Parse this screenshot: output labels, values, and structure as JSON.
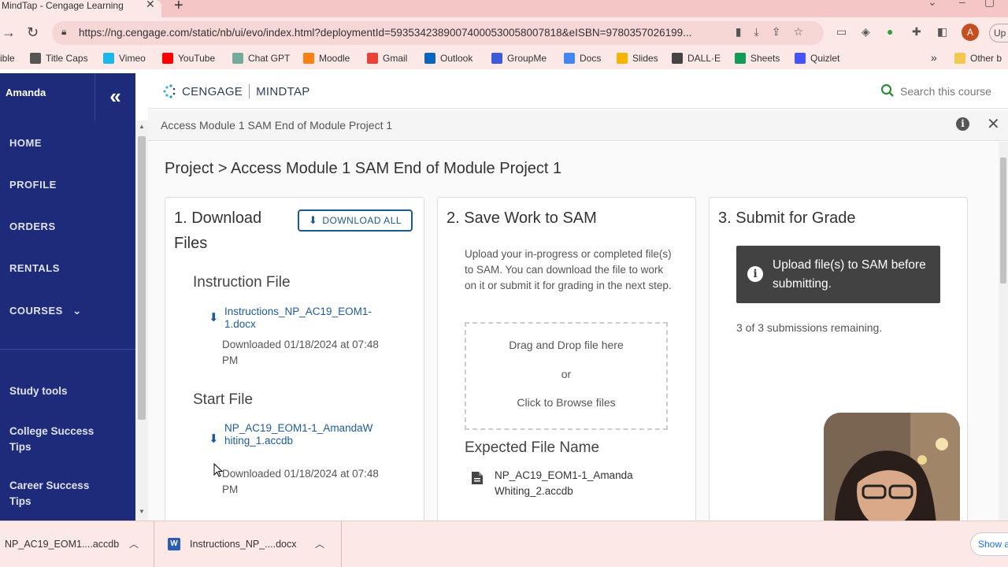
{
  "browser": {
    "tab_title": "MindTap - Cengage Learning",
    "url": "https://ng.cengage.com/static/nb/ui/evo/index.html?deploymentId=59353423890074000530058007818&eISBN=9780357026199...",
    "profile_initial": "A",
    "update_label": "Up",
    "bookmarks": [
      {
        "label": "ible",
        "icon": "bookmark-icon",
        "color": "#888888"
      },
      {
        "label": "Title Caps",
        "icon": "title-caps-icon",
        "color": "#555555"
      },
      {
        "label": "Vimeo",
        "icon": "vimeo-icon",
        "color": "#1ab7ea"
      },
      {
        "label": "YouTube",
        "icon": "youtube-icon",
        "color": "#ff0000"
      },
      {
        "label": "Chat GPT",
        "icon": "chatgpt-icon",
        "color": "#74aa9c"
      },
      {
        "label": "Moodle",
        "icon": "moodle-icon",
        "color": "#f98012"
      },
      {
        "label": "Gmail",
        "icon": "gmail-icon",
        "color": "#ea4335"
      },
      {
        "label": "Outlook",
        "icon": "outlook-icon",
        "color": "#0a64c2"
      },
      {
        "label": "GroupMe",
        "icon": "groupme-icon",
        "color": "#3b5bdb"
      },
      {
        "label": "Docs",
        "icon": "docs-icon",
        "color": "#4285f4"
      },
      {
        "label": "Slides",
        "icon": "slides-icon",
        "color": "#f4b400"
      },
      {
        "label": "DALL·E",
        "icon": "dalle-icon",
        "color": "#444444"
      },
      {
        "label": "Sheets",
        "icon": "sheets-icon",
        "color": "#0f9d58"
      },
      {
        "label": "Quizlet",
        "icon": "quizlet-icon",
        "color": "#4255ff"
      }
    ],
    "bookmarks_more": "»",
    "other_bookmarks": "Other b"
  },
  "sidebar": {
    "user": "Amanda",
    "collapse_glyph": "«",
    "nav_items": [
      "HOME",
      "PROFILE",
      "ORDERS",
      "RENTALS",
      "COURSES"
    ],
    "courses_chevron": "⌄",
    "tools": [
      "Study tools",
      "College Success Tips",
      "Career Success Tips"
    ]
  },
  "header": {
    "brand": "CENGAGE",
    "product": "MINDTAP",
    "search_placeholder": "Search this course"
  },
  "activity": {
    "title": "Access Module 1 SAM End of Module Project 1"
  },
  "page": {
    "breadcrumb_root": "Project",
    "breadcrumb_sep": ">",
    "breadcrumb_current": "Access Module 1 SAM End of Module Project 1"
  },
  "download_card": {
    "title": "1. Download Files",
    "download_all": "DOWNLOAD ALL",
    "instruction_heading": "Instruction File",
    "instruction_file": "Instructions_NP_AC19_EOM1-1.docx",
    "instruction_status": "Downloaded 01/18/2024 at 07:48 PM",
    "start_heading": "Start File",
    "start_file": "NP_AC19_EOM1-1_AmandaWhiting_1.accdb",
    "start_status": "Downloaded 01/18/2024 at 07:48 PM"
  },
  "save_card": {
    "title": "2. Save Work to SAM",
    "description": "Upload your in-progress or completed file(s) to SAM. You can download the file to work on it or submit it for grading in the next step.",
    "drop_line1": "Drag and Drop file here",
    "drop_or": "or",
    "drop_line2": "Click to Browse files",
    "expected_heading": "Expected File Name",
    "expected_file": "NP_AC19_EOM1-1_AmandaWhiting_2.accdb"
  },
  "submit_card": {
    "title": "3. Submit for Grade",
    "notice": "Upload file(s) to SAM before submitting.",
    "remaining": "3 of 3 submissions remaining."
  },
  "download_bar": {
    "items": [
      "NP_AC19_EOM1....accdb",
      "Instructions_NP_....docx"
    ],
    "show_all": "Show a"
  }
}
